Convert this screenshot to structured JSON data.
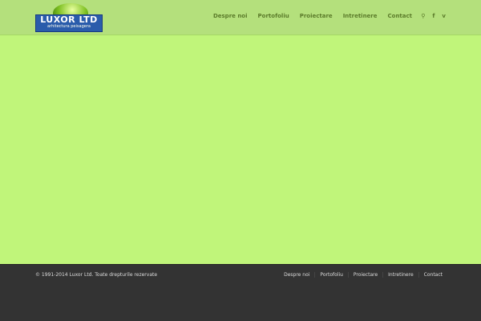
{
  "logo": {
    "title": "LUXOR LTD",
    "subtitle": "arhitectura peisagera"
  },
  "nav": [
    "Despre noi",
    "Portofoliu",
    "Proiectare",
    "Intretinere",
    "Contact"
  ],
  "social": {
    "search": "⚲",
    "facebook": "f",
    "vimeo": "v"
  },
  "footer": {
    "copyright": "© 1991-2014 Luxor Ltd. Toate drepturile rezervate",
    "links": [
      "Despre noi",
      "Portofoliu",
      "Proiectare",
      "Intretinere",
      "Contact"
    ]
  }
}
